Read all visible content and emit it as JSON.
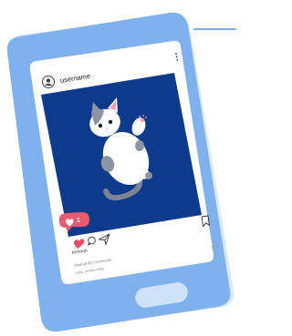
{
  "post": {
    "username": "username",
    "likes_badge": "1",
    "caption_user": "Kimnun",
    "comments_link": "View all 82 Comments",
    "caption_extra": "ratio_vmina fokyi"
  },
  "colors": {
    "phone_body": "#7fb1ec",
    "phone_screen": "#ffffff",
    "photo_bg": "#0e3a8c",
    "like_red": "#e94f64",
    "notif_bg": "#e85b6e",
    "home_button": "#cfe1f7"
  },
  "icons": [
    "avatar-icon",
    "more-icon",
    "heart-icon",
    "comment-icon",
    "share-icon",
    "bookmark-icon",
    "notification-heart-icon"
  ]
}
